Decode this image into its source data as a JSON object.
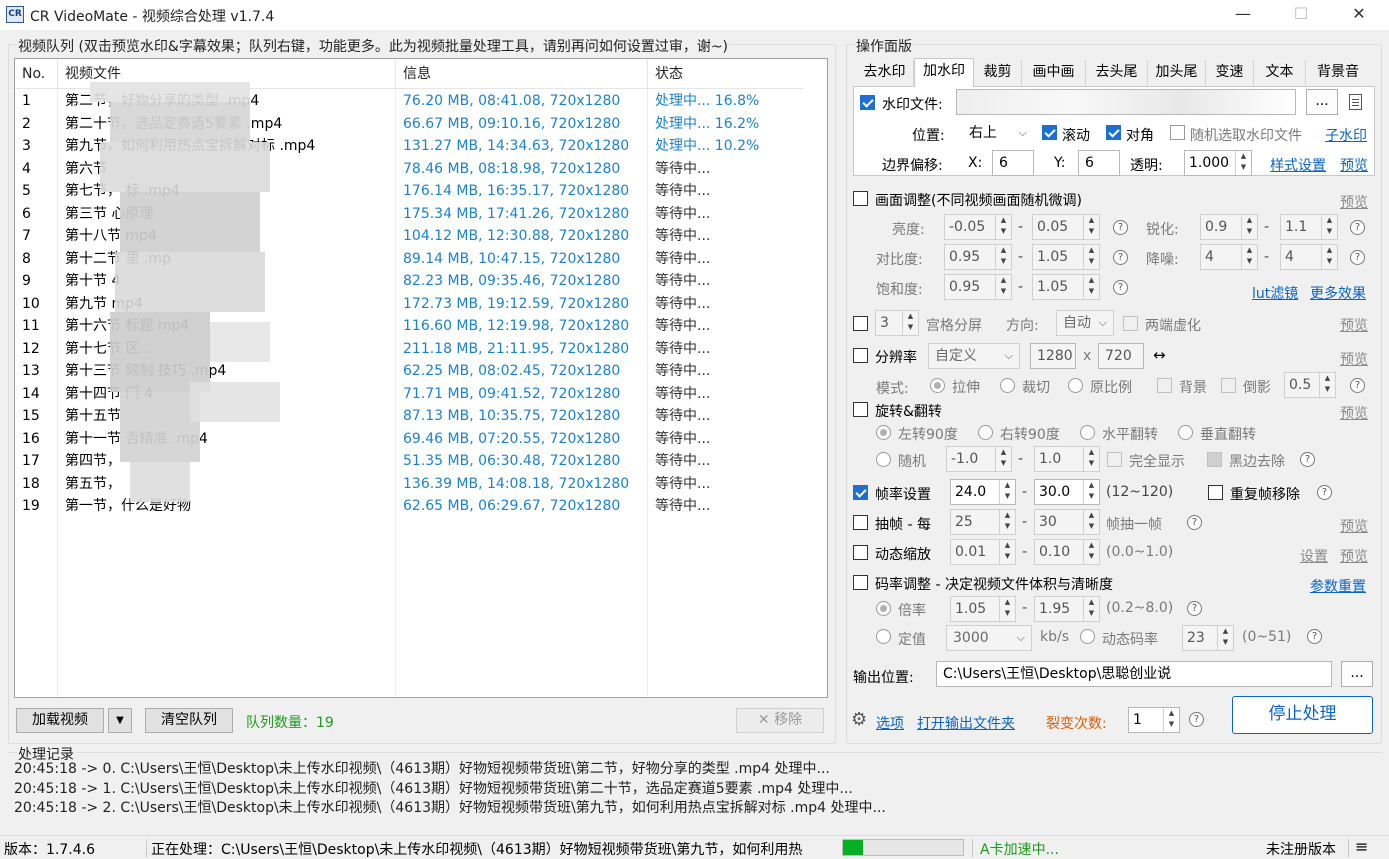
{
  "window": {
    "app_icon": "CR",
    "title": "CR VideoMate - 视频综合处理 v1.7.4",
    "minimize_glyph": "—",
    "maximize_glyph": "☐",
    "close_glyph": "✕"
  },
  "queue": {
    "group_title": "视频队列 (双击预览水印&字幕效果；队列右键，功能更多。此为视频批量处理工具，请别再问如何设置过审，谢~)",
    "columns": [
      "No.",
      "视频文件",
      "信息",
      "状态"
    ],
    "rows": [
      {
        "no": "1",
        "file": "第二节，好物分享的类型 .mp4",
        "info": "76.20 MB, 08:41.08, 720x1280",
        "status": "处理中... 16.8%"
      },
      {
        "no": "2",
        "file": "第二十节，选品定赛道5要素 .mp4",
        "info": "66.67 MB, 09:10.16, 720x1280",
        "status": "处理中... 16.2%"
      },
      {
        "no": "3",
        "file": "第九节，如何利用热点宝拆解对标 .mp4",
        "info": "131.27 MB, 14:34.63, 720x1280",
        "status": "处理中... 10.2%"
      },
      {
        "no": "4",
        "file": "第六节",
        "info": "78.46 MB, 08:18.98, 720x1280",
        "status": "等待中..."
      },
      {
        "no": "5",
        "file": "第七节，                      标 .mp4",
        "info": "176.14 MB, 16:35.17, 720x1280",
        "status": "等待中..."
      },
      {
        "no": "6",
        "file": "第三节                 心原理",
        "info": "175.34 MB, 17:41.26, 720x1280",
        "status": "等待中..."
      },
      {
        "no": "7",
        "file": "第十八节            mp4",
        "info": "104.12 MB, 12:30.88, 720x1280",
        "status": "等待中..."
      },
      {
        "no": "8",
        "file": "第十二节              里 .mp",
        "info": "89.14 MB, 10:47.15, 720x1280",
        "status": "等待中..."
      },
      {
        "no": "9",
        "file": "第十节               4",
        "info": "82.23 MB, 09:35.46, 720x1280",
        "status": "等待中..."
      },
      {
        "no": "10",
        "file": "第九节            mp4",
        "info": "172.73 MB, 19:12.59, 720x1280",
        "status": "等待中..."
      },
      {
        "no": "11",
        "file": "第十六节              标题      mp4",
        "info": "116.60 MB, 12:19.98, 720x1280",
        "status": "等待中..."
      },
      {
        "no": "12",
        "file": "第十七节            区 .",
        "info": "211.18 MB, 21:11.95, 720x1280",
        "status": "等待中..."
      },
      {
        "no": "13",
        "file": "第十三节          频制         技巧 .mp4",
        "info": "62.25 MB, 08:02.45, 720x1280",
        "status": "等待中..."
      },
      {
        "no": "14",
        "file": "第十四节            门       4",
        "info": "71.71 MB, 09:41.52, 720x1280",
        "status": "等待中..."
      },
      {
        "no": "15",
        "file": "第十五节",
        "info": "87.13 MB, 10:35.75, 720x1280",
        "status": "等待中..."
      },
      {
        "no": "16",
        "file": "第十一节                     否精准 .mp4",
        "info": "69.46 MB, 07:20.55, 720x1280",
        "status": "等待中..."
      },
      {
        "no": "17",
        "file": "第四节，",
        "info": "51.35 MB, 06:30.48, 720x1280",
        "status": "等待中..."
      },
      {
        "no": "18",
        "file": "第五节，",
        "info": "136.39 MB, 14:08.18, 720x1280",
        "status": "等待中..."
      },
      {
        "no": "19",
        "file": "第一节，什么是好物",
        "info": "62.65 MB, 06:29.67, 720x1280",
        "status": "等待中..."
      }
    ],
    "add_button": "加载视频",
    "add_dropdown": "▼",
    "clear_button": "清空队列",
    "count_label": "队列数量：19",
    "remove_button": "移除",
    "remove_icon": "✕"
  },
  "panel": {
    "group_title": "操作面版",
    "tabs": [
      "去水印",
      "加水印",
      "裁剪",
      "画中画",
      "去头尾",
      "加头尾",
      "变速",
      "文本",
      "背景音"
    ],
    "active_tab": "加水印",
    "watermark": {
      "file_label": "水印文件:",
      "browse": "...",
      "position_label": "位置:",
      "position_value": "右上",
      "scroll_label": "滚动",
      "align_label": "对角",
      "random_label": "随机选取水印文件",
      "sub_watermark": "子水印",
      "offset_label": "边界偏移:",
      "x_label": "X:",
      "x_value": "6",
      "y_label": "Y:",
      "y_value": "6",
      "opacity_label": "透明:",
      "opacity_value": "1.000",
      "style_link": "样式设置",
      "preview_link": "预览"
    },
    "picture": {
      "title": "画面调整(不同视频画面随机微调)",
      "preview": "预览",
      "brightness": "亮度:",
      "b_min": "-0.05",
      "b_max": "0.05",
      "sharpen": "锐化:",
      "s_min": "0.9",
      "s_max": "1.1",
      "contrast": "对比度:",
      "c_min": "0.95",
      "c_max": "1.05",
      "denoise": "降噪:",
      "d_min": "4",
      "d_max": "4",
      "saturation": "饱和度:",
      "sa_min": "0.95",
      "sa_max": "1.05",
      "lut_link": "lut滤镜",
      "more_effects": "更多效果"
    },
    "grid": {
      "value": "3",
      "label": "宫格分屏",
      "dir_label": "方向:",
      "dir_value": "自动",
      "blur_label": "两端虚化",
      "preview": "预览"
    },
    "resolution": {
      "label": "分辨率",
      "preset": "自定义",
      "w": "1280",
      "x": "x",
      "h": "720",
      "swap": "↔",
      "preview": "预览",
      "mode_label": "模式:",
      "stretch": "拉伸",
      "crop": "裁切",
      "ratio": "原比例",
      "bg": "背景",
      "shadow": "倒影",
      "shadow_val": "0.5"
    },
    "rotate": {
      "label": "旋转&翻转",
      "preview": "预览",
      "left90": "左转90度",
      "right90": "右转90度",
      "hflip": "水平翻转",
      "vflip": "垂直翻转",
      "random": "随机",
      "r_min": "-1.0",
      "r_max": "1.0",
      "full": "完全显示",
      "black": "黑边去除"
    },
    "framerate": {
      "label": "帧率设置",
      "min": "24.0",
      "max": "30.0",
      "range": "(12~120)",
      "dup": "重复帧移除"
    },
    "extract": {
      "label": "抽帧 - 每",
      "min": "25",
      "max": "30",
      "suffix": "帧抽一帧",
      "preview": "预览"
    },
    "zoom": {
      "label": "动态缩放",
      "min": "0.01",
      "max": "0.10",
      "range": "(0.0~1.0)",
      "settings": "设置",
      "preview": "预览"
    },
    "bitrate": {
      "label": "码率调整 - 决定视频文件体积与清晰度",
      "reset": "参数重置",
      "ratio_label": "倍率",
      "ratio_min": "1.05",
      "ratio_max": "1.95",
      "ratio_range": "(0.2~8.0)",
      "fixed_label": "定值",
      "fixed_value": "3000",
      "unit": "kb/s",
      "dyn_label": "动态码率",
      "dyn_value": "23",
      "dyn_range": "(0~51)"
    },
    "output": {
      "label": "输出位置:",
      "path": "C:\\Users\\王恒\\Desktop\\思聪创业说",
      "browse": "..."
    },
    "footer": {
      "options": "选项",
      "open_folder": "打开输出文件夹",
      "fission_label": "裂变次数:",
      "fission_value": "1",
      "stop_button": "停止处理"
    }
  },
  "log": {
    "title": "处理记录",
    "lines": [
      "20:45:18 -> 0. C:\\Users\\王恒\\Desktop\\未上传水印视频\\（4613期）好物短视频带货班\\第二节，好物分享的类型 .mp4 处理中...",
      "20:45:18 -> 1. C:\\Users\\王恒\\Desktop\\未上传水印视频\\（4613期）好物短视频带货班\\第二十节，选品定赛道5要素 .mp4 处理中...",
      "20:45:18 -> 2. C:\\Users\\王恒\\Desktop\\未上传水印视频\\（4613期）好物短视频带货班\\第九节，如何利用热点宝拆解对标 .mp4 处理中..."
    ]
  },
  "status": {
    "version": "版本：1.7.4.6",
    "processing": "正在处理：C:\\Users\\王恒\\Desktop\\未上传水印视频\\（4613期）好物短视频带货班\\第九节，如何利用热",
    "progress_fraction": 0.17,
    "gpu": "A卡加速中...",
    "license": "未注册版本",
    "menu_icon": "≡"
  },
  "colors": {
    "accent": "#1a82d4",
    "link": "#0a64c8",
    "count": "#1e9a1e",
    "gpu": "#1e9a1e",
    "fission": "#e05a00",
    "progress": "#06b025"
  }
}
